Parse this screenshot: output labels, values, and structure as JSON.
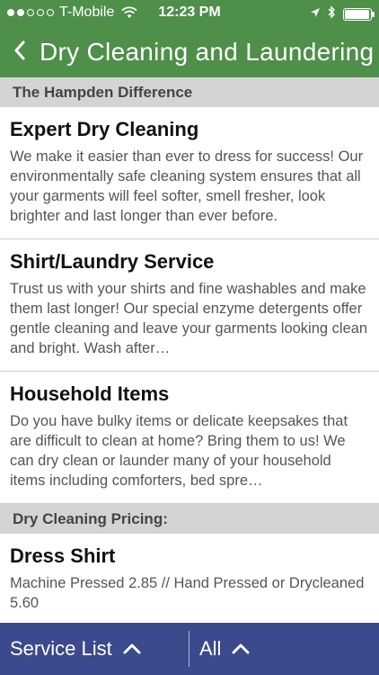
{
  "status_bar": {
    "carrier": "T-Mobile",
    "time": "12:23 PM"
  },
  "nav": {
    "title": "Dry Cleaning and Laundering"
  },
  "sections": [
    {
      "header": "The Hampden Difference",
      "items": [
        {
          "title": "Expert Dry Cleaning",
          "description": "We make it easier than ever to dress for success! Our environmentally safe cleaning system ensures that all your garments will feel softer, smell fresher, look brighter and last longer than ever before."
        },
        {
          "title": "Shirt/Laundry Service",
          "description": "Trust us with your shirts and fine washables and make them last longer! Our special enzyme detergents offer gentle cleaning and leave your garments looking clean and bright. Wash after…"
        },
        {
          "title": "Household Items",
          "description": "Do you have bulky items or delicate keepsakes that are difficult to clean at home? Bring them to us! We can dry clean or launder many of your household items including comforters, bed spre…"
        }
      ]
    },
    {
      "header": "Dry Cleaning Pricing:",
      "items": [
        {
          "title": "Dress Shirt",
          "description": "Machine Pressed 2.85 // Hand Pressed or Drycleaned 5.60"
        }
      ]
    }
  ],
  "toolbar": {
    "service_list_label": "Service List",
    "filter_label": "All"
  },
  "colors": {
    "nav_green": "#4e8f4a",
    "toolbar_blue": "#3b4a8d",
    "section_gray": "#d4d4d4"
  },
  "battery_level": 0.95
}
